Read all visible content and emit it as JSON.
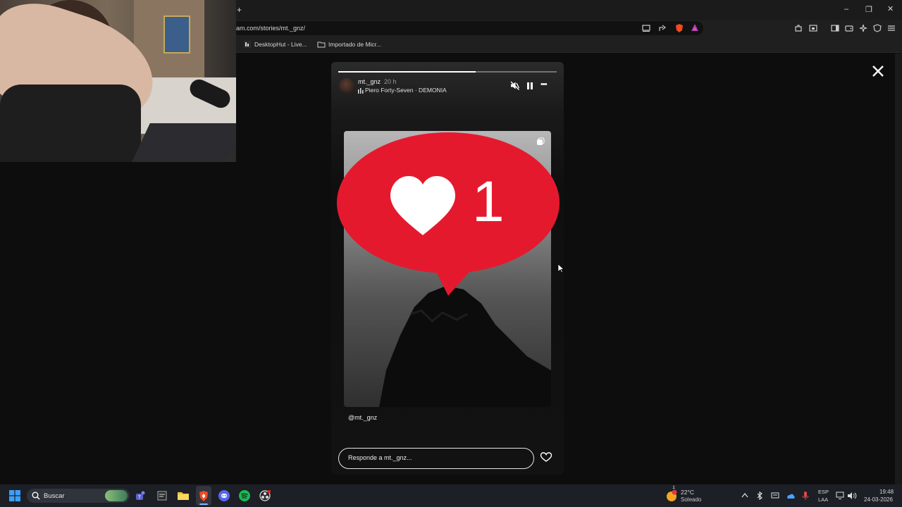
{
  "browser": {
    "url_text": "am.com/stories/mt._gnz/",
    "new_tab_symbol": "+",
    "bookmarks": [
      {
        "label": "DesktopHut - Live..."
      },
      {
        "label": "Importado de Micr..."
      }
    ],
    "window_controls": {
      "minimize": "–",
      "restore": "❐",
      "close": "✕"
    }
  },
  "story": {
    "username": "mt._gnz",
    "time_ago": "20 h",
    "music": "Piero Forty-Seven · DEMONIA",
    "progress": 0.63,
    "like_count": "1",
    "mention": "@mt._gnz",
    "reply_placeholder": "Responde a mt._gnz...",
    "close_symbol": "✕",
    "more_symbol": "•••"
  },
  "taskbar": {
    "search_label": "Buscar",
    "weather_temp": "22°C",
    "weather_desc": "Soleado",
    "weather_badge": "1",
    "language_top": "ESP",
    "language_bottom": "LAA",
    "time": "19:48",
    "date": "24-03-2026"
  },
  "colors": {
    "accent_red": "#e5192e",
    "brave_orange": "#f04a20",
    "spotify_green": "#1db954",
    "discord_blue": "#5865f2"
  },
  "icons": [
    "windows-start-icon",
    "search-icon",
    "widgets-icon",
    "teams-icon",
    "app-icon",
    "folder-icon",
    "brave-icon",
    "discord-icon",
    "spotify-icon",
    "obs-icon",
    "weather-icon",
    "chevron-up-icon",
    "bluetooth-icon",
    "keyboard-icon",
    "cloud-icon",
    "mic-icon",
    "network-icon",
    "volume-icon"
  ]
}
